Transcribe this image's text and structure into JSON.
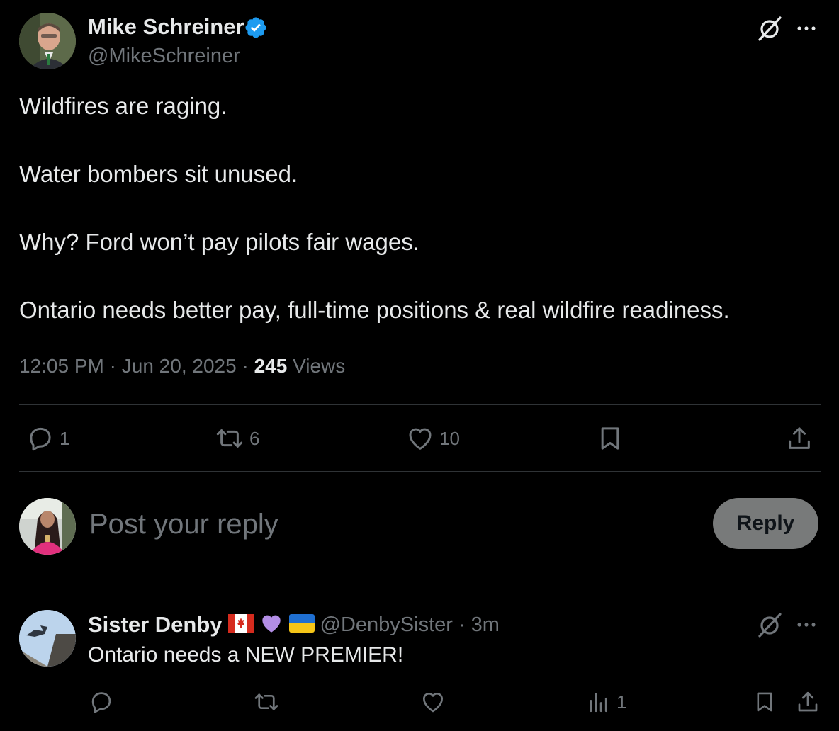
{
  "post": {
    "author": {
      "name": "Mike Schreiner",
      "handle": "@MikeSchreiner",
      "verified": true
    },
    "lines": [
      "Wildfires are raging.",
      "Water bombers sit unused.",
      "Why? Ford won’t pay pilots fair wages.",
      "Ontario needs better pay, full-time positions & real wildfire readiness."
    ],
    "time": "12:05 PM",
    "date": "Jun 20, 2025",
    "separator": "·",
    "views_count": "245",
    "views_label": "Views",
    "actions": {
      "replies": "1",
      "reposts": "6",
      "likes": "10"
    },
    "icons": [
      "grok-icon",
      "more-icon",
      "verified-badge-icon",
      "reply-icon",
      "repost-icon",
      "like-icon",
      "bookmark-icon",
      "share-icon"
    ]
  },
  "composer": {
    "placeholder": "Post your reply",
    "button_label": "Reply"
  },
  "reply": {
    "author": {
      "name": "Sister Denby",
      "handle": "@DenbySister",
      "time": "3m",
      "name_emojis": [
        "canada-flag",
        "purple-heart",
        "ukraine-flag"
      ]
    },
    "text": "Ontario needs a NEW PREMIER!",
    "actions": {
      "views": "1"
    },
    "icons": [
      "grok-icon",
      "more-icon",
      "reply-icon",
      "repost-icon",
      "like-icon",
      "views-icon",
      "bookmark-icon",
      "share-icon"
    ]
  },
  "colors": {
    "background": "#000000",
    "text_primary": "#e7e9ea",
    "text_muted": "#71767b",
    "divider": "#2f3336",
    "verified_blue": "#1d9bf0",
    "reply_button_bg": "#787a7a"
  }
}
